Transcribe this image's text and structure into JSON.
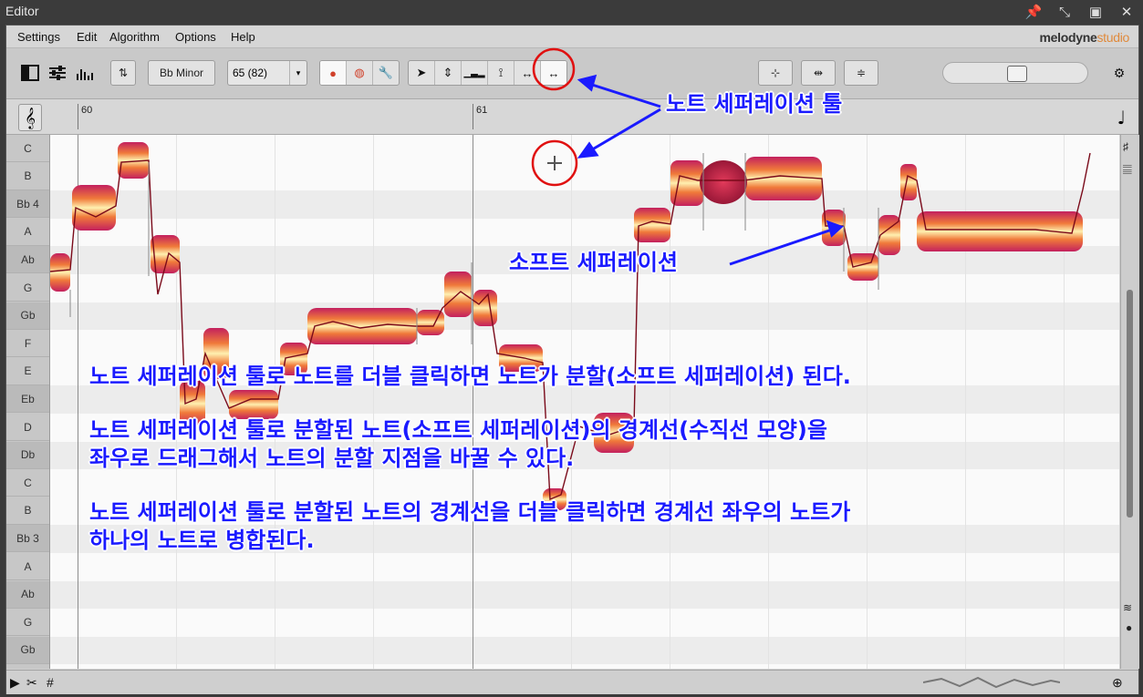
{
  "window": {
    "title": "Editor"
  },
  "menu": {
    "items": [
      "Settings",
      "Edit",
      "Algorithm",
      "Options",
      "Help"
    ]
  },
  "brand": {
    "name": "melodyne",
    "edition": "studio"
  },
  "toolbar": {
    "key_button": "Bb Minor",
    "tempo_value": "65 (82)"
  },
  "ruler": {
    "bar_60": "60",
    "bar_61": "61"
  },
  "pitch_labels": [
    "C",
    "B",
    "Bb 4",
    "A",
    "Ab",
    "G",
    "Gb",
    "F",
    "E",
    "Eb",
    "D",
    "Db",
    "C",
    "B",
    "Bb 3",
    "A",
    "Ab",
    "G",
    "Gb"
  ],
  "annotations": {
    "tool_label": "노트 세퍼레이션 툴",
    "soft_label": "소프트 세퍼레이션",
    "line1": "노트 세퍼레이션 툴로 노트를 더블 클릭하면 노트가 분할(소프트 세퍼레이션) 된다.",
    "line2": "노트 세퍼레이션 툴로 분할된 노트(소프트 세퍼레이션)의 경계선(수직선 모양)을",
    "line3": "좌우로 드래그해서 노트의 분할 지점을 바꿀 수 있다.",
    "line4": "노트 세퍼레이션 툴로 분할된 노트의 경계선을 더블 클릭하면 경계선 좌우의 노트가",
    "line5": "하나의 노트로 병합된다."
  },
  "colors": {
    "annotation": "#1a1aff",
    "highlight_circle": "#e01010",
    "blob_outer": "#c0206a",
    "blob_inner": "#ffd27a"
  }
}
